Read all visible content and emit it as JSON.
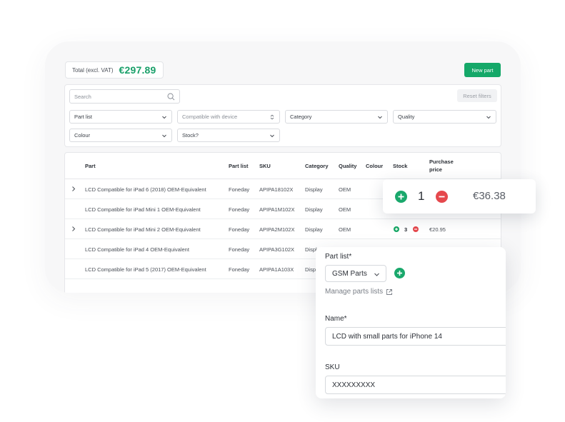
{
  "header": {
    "total_label": "Total (excl. VAT)",
    "total_value": "€297.89",
    "new_part_label": "New part"
  },
  "filters": {
    "search_placeholder": "Search",
    "reset_label": "Reset filters",
    "part_list": "Part list",
    "compatible": "Compatible with device",
    "category": "Category",
    "quality": "Quality",
    "colour": "Colour",
    "stock": "Stock?"
  },
  "table": {
    "columns": {
      "part": "Part",
      "part_list": "Part list",
      "sku": "SKU",
      "category": "Category",
      "quality": "Quality",
      "colour": "Colour",
      "stock": "Stock",
      "purchase_price_1": "Purchase",
      "purchase_price_2": "price"
    },
    "rows": [
      {
        "part": "LCD Compatible for iPad 6 (2018) OEM-Equivalent",
        "part_list": "Foneday",
        "sku": "APIPA18102X",
        "category": "Display",
        "quality": "OEM",
        "stock": "",
        "price": ""
      },
      {
        "part": "LCD Compatible for iPad Mini 1 OEM-Equivalent",
        "part_list": "Foneday",
        "sku": "APIPA1M102X",
        "category": "Display",
        "quality": "OEM",
        "stock": "",
        "price": ""
      },
      {
        "part": "LCD Compatible for iPad Mini 2 OEM-Equivalent",
        "part_list": "Foneday",
        "sku": "APIPA2M102X",
        "category": "Display",
        "quality": "OEM",
        "stock": "3",
        "price": "€20.95"
      },
      {
        "part": "LCD Compatible for iPad 4 OEM-Equivalent",
        "part_list": "Foneday",
        "sku": "APIPA3G102X",
        "category": "Displ",
        "quality": "",
        "stock": "",
        "price": ""
      },
      {
        "part": "LCD Compatible for iPad 5 (2017) OEM-Equivalent",
        "part_list": "Foneday",
        "sku": "APIPA1A103X",
        "category": "Displ",
        "quality": "",
        "stock": "",
        "price": ""
      }
    ]
  },
  "stock_popup": {
    "quantity": "1",
    "price": "€36.38"
  },
  "form": {
    "part_list_label": "Part list*",
    "part_list_value": "GSM Parts",
    "manage_link": "Manage parts lists",
    "name_label": "Name*",
    "name_value": "LCD with small parts for iPhone 14",
    "sku_label": "SKU",
    "sku_value": "XXXXXXXXX"
  },
  "colors": {
    "accent_green": "#15a869",
    "danger_red": "#e5484d"
  }
}
